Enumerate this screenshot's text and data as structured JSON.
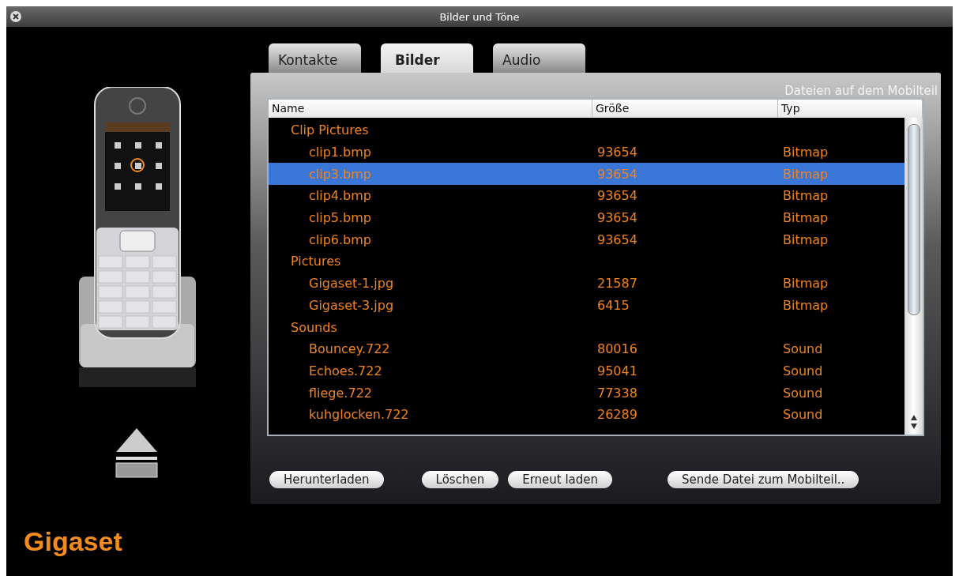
{
  "window": {
    "title": "Bilder und Töne"
  },
  "tabs": [
    {
      "label": "Kontakte",
      "selected": false
    },
    {
      "label": "Bilder",
      "selected": true
    },
    {
      "label": "Audio",
      "selected": false
    }
  ],
  "panel": {
    "caption": "Dateien auf dem Mobilteil"
  },
  "table": {
    "columns": [
      "Name",
      "Größe",
      "Typ"
    ],
    "rows": [
      {
        "name": "Clip Pictures",
        "selected": false,
        "children": [
          {
            "name": "clip1.bmp",
            "size": "93654",
            "type": "Bitmap",
            "selected": false
          },
          {
            "name": "clip3.bmp",
            "size": "93654",
            "type": "Bitmap",
            "selected": true
          },
          {
            "name": "clip4.bmp",
            "size": "93654",
            "type": "Bitmap",
            "selected": false
          },
          {
            "name": "clip5.bmp",
            "size": "93654",
            "type": "Bitmap",
            "selected": false
          },
          {
            "name": "clip6.bmp",
            "size": "93654",
            "type": "Bitmap",
            "selected": false
          }
        ]
      },
      {
        "name": "Pictures",
        "selected": false,
        "children": [
          {
            "name": "Gigaset-1.jpg",
            "size": "21587",
            "type": "Bitmap",
            "selected": false
          },
          {
            "name": "Gigaset-3.jpg",
            "size": "6415",
            "type": "Bitmap",
            "selected": false
          }
        ]
      },
      {
        "name": "Sounds",
        "selected": false,
        "children": [
          {
            "name": "Bouncey.722",
            "size": "80016",
            "type": "Sound",
            "selected": false
          },
          {
            "name": "Echoes.722",
            "size": "95041",
            "type": "Sound",
            "selected": false
          },
          {
            "name": "fliege.722",
            "size": "77338",
            "type": "Sound",
            "selected": false
          },
          {
            "name": "kuhglocken.722",
            "size": "26289",
            "type": "Sound",
            "selected": false
          }
        ]
      }
    ]
  },
  "buttons": [
    "Herunterladen",
    "Löschen",
    "Erneut laden",
    "Sende Datei zum Mobilteil.."
  ],
  "brand": "Gigaset"
}
